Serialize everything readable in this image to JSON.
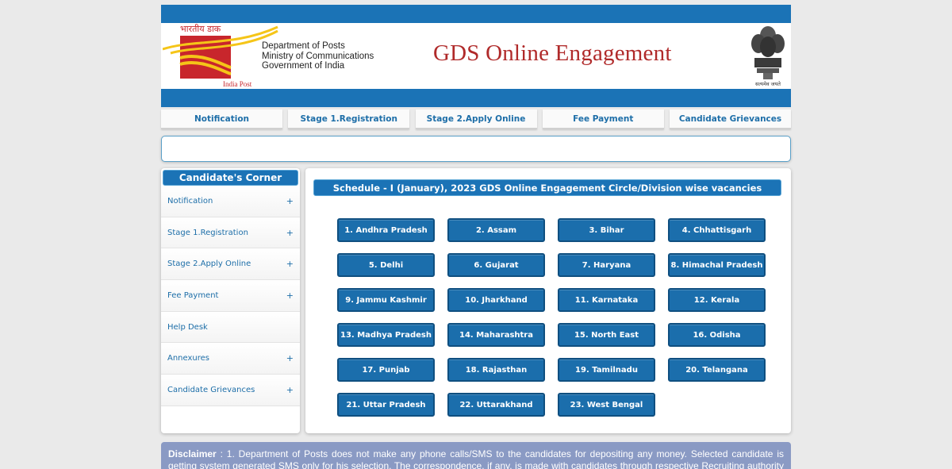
{
  "header": {
    "hindi_logo_text": "भारतीय डाक",
    "logo_caption": "India Post",
    "dept_line1": "Department of Posts",
    "dept_line2": "Ministry of Communications",
    "dept_line3": "Government of India",
    "title": "GDS Online Engagement",
    "emblem_caption": "सत्यमेव जयते"
  },
  "topnav": [
    {
      "label": "Notification"
    },
    {
      "label": "Stage 1.Registration"
    },
    {
      "label": "Stage 2.Apply Online"
    },
    {
      "label": "Fee Payment"
    },
    {
      "label": "Candidate Grievances"
    }
  ],
  "sidebar": {
    "title": "Candidate's Corner",
    "items": [
      {
        "label": "Notification",
        "expandable": "+"
      },
      {
        "label": "Stage 1.Registration",
        "expandable": "+"
      },
      {
        "label": "Stage 2.Apply Online",
        "expandable": "+"
      },
      {
        "label": "Fee Payment",
        "expandable": "+"
      },
      {
        "label": "Help Desk",
        "expandable": ""
      },
      {
        "label": "Annexures",
        "expandable": "+"
      },
      {
        "label": "Candidate Grievances",
        "expandable": "+"
      }
    ]
  },
  "main": {
    "heading": "Schedule - I (January), 2023 GDS Online Engagement Circle/Division wise vacancies",
    "circles": [
      "1. Andhra Pradesh",
      "2. Assam",
      "3. Bihar",
      "4. Chhattisgarh",
      "5. Delhi",
      "6. Gujarat",
      "7. Haryana",
      "8. Himachal Pradesh",
      "9. Jammu Kashmir",
      "10. Jharkhand",
      "11. Karnataka",
      "12. Kerala",
      "13. Madhya Pradesh",
      "14. Maharashtra",
      "15. North East",
      "16. Odisha",
      "17. Punjab",
      "18. Rajasthan",
      "19. Tamilnadu",
      "20. Telangana",
      "21. Uttar Pradesh",
      "22. Uttarakhand",
      "23. West Bengal"
    ]
  },
  "disclaimer": {
    "label": "Disclaimer",
    "text": " : 1. Department of Posts does not make any phone calls/SMS to the candidates for depositing any money. Selected candidate is getting system generated SMS only for his selection. The correspondence, if any, is made with candidates through respective Recruiting authority only."
  },
  "colors": {
    "brand_blue": "#1b73b6",
    "title_red": "#b02a2a",
    "logo_red": "#c8262c",
    "logo_yellow": "#f5c518",
    "disclaimer_bg": "#8a9ac4"
  }
}
